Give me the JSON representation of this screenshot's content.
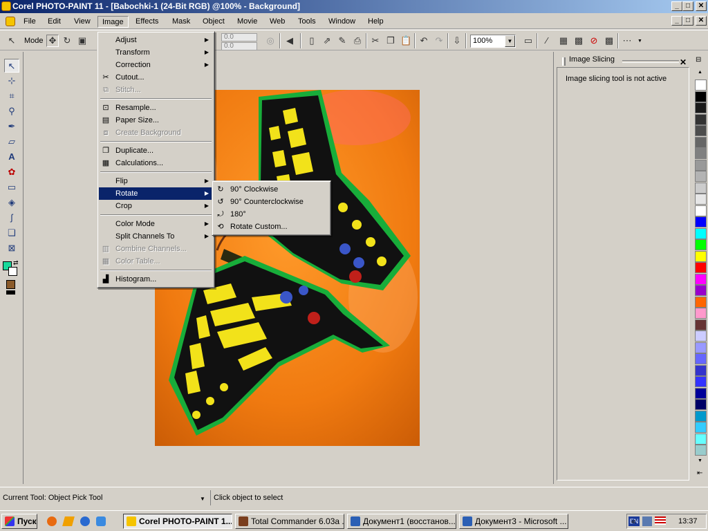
{
  "window": {
    "title": "Corel PHOTO-PAINT 11 - [Babochki-1 (24-Bit RGB) @100% - Background]",
    "buttons": {
      "minimize": "_",
      "maximize": "□",
      "close": "✕"
    }
  },
  "menubar": {
    "items": [
      "File",
      "Edit",
      "View",
      "Image",
      "Effects",
      "Mask",
      "Object",
      "Movie",
      "Web",
      "Tools",
      "Window",
      "Help"
    ],
    "active": "Image"
  },
  "toolbar": {
    "mode_label": "Mode",
    "field1_value": "0.0",
    "field2_value": "0.0",
    "zoom_value": "100%"
  },
  "image_menu": {
    "items": [
      {
        "label": "Adjust",
        "submenu": true,
        "disabled": false
      },
      {
        "label": "Transform",
        "submenu": true,
        "disabled": false
      },
      {
        "label": "Correction",
        "submenu": true,
        "disabled": false
      },
      {
        "label": "Cutout...",
        "submenu": false,
        "disabled": false,
        "icon": "scissors-icon"
      },
      {
        "label": "Stitch...",
        "submenu": false,
        "disabled": true,
        "icon": "stitch-icon"
      },
      {
        "sep": true
      },
      {
        "label": "Resample...",
        "submenu": false,
        "disabled": false,
        "icon": "resample-icon"
      },
      {
        "label": "Paper Size...",
        "submenu": false,
        "disabled": false,
        "icon": "paper-size-icon"
      },
      {
        "label": "Create Background",
        "submenu": false,
        "disabled": true,
        "icon": "create-background-icon"
      },
      {
        "sep": true
      },
      {
        "label": "Duplicate...",
        "submenu": false,
        "disabled": false,
        "icon": "duplicate-icon"
      },
      {
        "label": "Calculations...",
        "submenu": false,
        "disabled": false,
        "icon": "calculations-icon"
      },
      {
        "sep": true
      },
      {
        "label": "Flip",
        "submenu": true,
        "disabled": false
      },
      {
        "label": "Rotate",
        "submenu": true,
        "disabled": false,
        "highlighted": true
      },
      {
        "label": "Crop",
        "submenu": true,
        "disabled": false
      },
      {
        "sep": true
      },
      {
        "label": "Color Mode",
        "submenu": true,
        "disabled": false
      },
      {
        "label": "Split Channels To",
        "submenu": true,
        "disabled": false
      },
      {
        "label": "Combine Channels...",
        "submenu": false,
        "disabled": true,
        "icon": "combine-channels-icon"
      },
      {
        "label": "Color Table...",
        "submenu": false,
        "disabled": true,
        "icon": "color-table-icon"
      },
      {
        "sep": true
      },
      {
        "label": "Histogram...",
        "submenu": false,
        "disabled": false,
        "icon": "histogram-icon"
      }
    ]
  },
  "rotate_submenu": {
    "items": [
      {
        "label": "90° Clockwise",
        "icon": "rotate-cw-icon"
      },
      {
        "label": "90° Counterclockwise",
        "icon": "rotate-ccw-icon"
      },
      {
        "label": "180°",
        "icon": "rotate-180-icon"
      },
      {
        "label": "Rotate Custom...",
        "icon": "rotate-custom-icon"
      }
    ]
  },
  "docker": {
    "title": "Image Slicing",
    "message": "Image slicing tool is not active"
  },
  "palette": {
    "colors": [
      "#ffffff",
      "#000000",
      "#1a1a1a",
      "#333333",
      "#4d4d4d",
      "#666666",
      "#808080",
      "#999999",
      "#b3b3b3",
      "#cccccc",
      "#e6e6e6",
      "#ffffff",
      "#0000ff",
      "#00ffff",
      "#00ff00",
      "#ffff00",
      "#ff0000",
      "#ff00ff",
      "#9900cc",
      "#ff6600",
      "#ff99cc",
      "#663333",
      "#ccccff",
      "#9999ff",
      "#6666ff",
      "#3333cc",
      "#3333ff",
      "#000099",
      "#000066",
      "#0099cc",
      "#33ccff",
      "#66ffff",
      "#99cccc"
    ]
  },
  "statusbar": {
    "current_tool": "Current Tool: Object Pick Tool",
    "hint": "Click object to select"
  },
  "taskbar": {
    "start": "Пуск",
    "tasks": [
      {
        "label": "Corel PHOTO-PAINT 1...",
        "active": true,
        "color": "#f5c400"
      },
      {
        "label": "Total Commander 6.03a ...",
        "active": false,
        "color": "#7a3e1e"
      },
      {
        "label": "Документ1 (восстанов...",
        "active": false,
        "color": "#2b5fb4"
      },
      {
        "label": "Документ3 - Microsoft ...",
        "active": false,
        "color": "#2b5fb4"
      }
    ],
    "lang": "EN",
    "clock": "13:37"
  }
}
